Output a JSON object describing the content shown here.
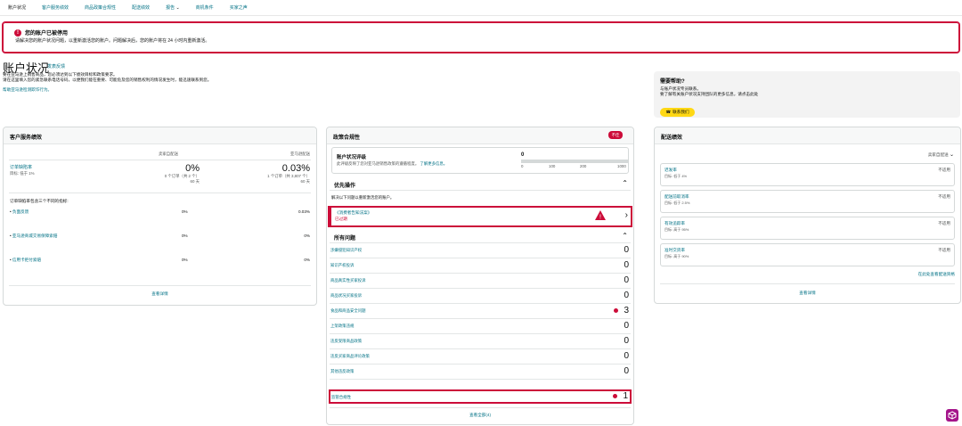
{
  "nav": [
    "账户状况",
    "客户服务绩效",
    "商品政策合规性",
    "配送绩效",
    "报告",
    "商机条件",
    "买家之声"
  ],
  "nav_report_chevron": "chevron-down-icon",
  "alert": {
    "title": "您的账户已被停用",
    "message": "请解决您的账户状况问题，以重新激活您的账户。问题解决后，您的账户将在 24 小时内重新激活。"
  },
  "page": {
    "title": "账户状况",
    "title_link": "发表反馈",
    "desc1": "要在亚马逊上销售商品，您必须达到以下绩效目标和政策要求。",
    "desc2": "请在这里填入您的紧急联系电话号码，以便我们能在重要、可能危及您的销售权利的情况发生时，能迅速联系到您。",
    "desc_link": "这里",
    "help_link": "帮助亚马逊检测欺诈行为。"
  },
  "help": {
    "title": "需要帮助?",
    "line1": "与账户状况专员联系。",
    "line2": "要了解有关账户状况支持团队的更多信息，请点击此处",
    "button": "联系我们"
  },
  "customer_service": {
    "title": "客户服务绩效",
    "col1": "卖家自配送",
    "col2": "亚马逊配送",
    "odr_label": "订单缺陷率",
    "odr_target": "目标: 低于 1%",
    "odr_val1": "0%",
    "odr_sub1": "0 个订单（共 2 个）",
    "odr_days1": "60 天",
    "odr_val2": "0.03%",
    "odr_sub2": "1 个订单（共 3,807 个）",
    "odr_days2": "60 天",
    "intro": "订单缺陷率包含三个不同的指标:",
    "metrics": [
      {
        "label": "负面反馈",
        "v1": "0%",
        "v2": "0.03%"
      },
      {
        "label": "亚马逊商城交易保障索赔",
        "v1": "0%",
        "v2": "0%"
      },
      {
        "label": "信用卡拒付索赔",
        "v1": "0%",
        "v2": "0%"
      }
    ],
    "footer": "查看详情"
  },
  "policy": {
    "title": "政策合规性",
    "badge": "不佳",
    "ahr_label": "账户状况评级",
    "ahr_desc": "此评级反映了您对亚马逊销售政策的遵循程度。",
    "ahr_link": "了解更多信息。",
    "ahr_value": "0",
    "scale": [
      "0",
      "100",
      "200",
      "1000"
    ],
    "priority_title": "优先操作",
    "priority_desc": "解决以下问题以重新激活您的账户。",
    "priority_item_label": "《消费者告知法案》",
    "priority_item_status": "已过期",
    "all_title": "所有问题",
    "issues": [
      {
        "label": "涉嫌侵犯知识产权",
        "count": "0"
      },
      {
        "label": "知识产权投诉",
        "count": "0"
      },
      {
        "label": "商品真实性买家投诉",
        "count": "0"
      },
      {
        "label": "商品状况买家投诉",
        "count": "0"
      },
      {
        "label": "食品和商品安全问题",
        "count": "3"
      },
      {
        "label": "上架政策违规",
        "count": "0"
      },
      {
        "label": "违反受限商品政策",
        "count": "0"
      },
      {
        "label": "违反买家商品评论政策",
        "count": "0"
      },
      {
        "label": "其他违反政策",
        "count": "0"
      },
      {
        "label": "监管合规性",
        "count": "1"
      }
    ],
    "footer": "查看全部(4)"
  },
  "shipping": {
    "title": "配送绩效",
    "filter": "卖家自配送",
    "items": [
      {
        "label": "迟发率",
        "goal": "目标: 低于 4%",
        "value": "不适用"
      },
      {
        "label": "配送前取消率",
        "goal": "目标: 低于 2.5%",
        "value": "不适用"
      },
      {
        "label": "有效追踪率",
        "goal": "目标: 高于 95%",
        "value": "不适用"
      },
      {
        "label": "准时交货率",
        "goal": "目标: 高于 90%",
        "value": "不适用"
      }
    ],
    "link": "在此处查看配送资格",
    "footer": "查看详情"
  },
  "colors": {
    "alert": "#cc0c39",
    "link": "#007185",
    "button": "#ffd814"
  },
  "assistant_icon": "cube-logo-icon"
}
